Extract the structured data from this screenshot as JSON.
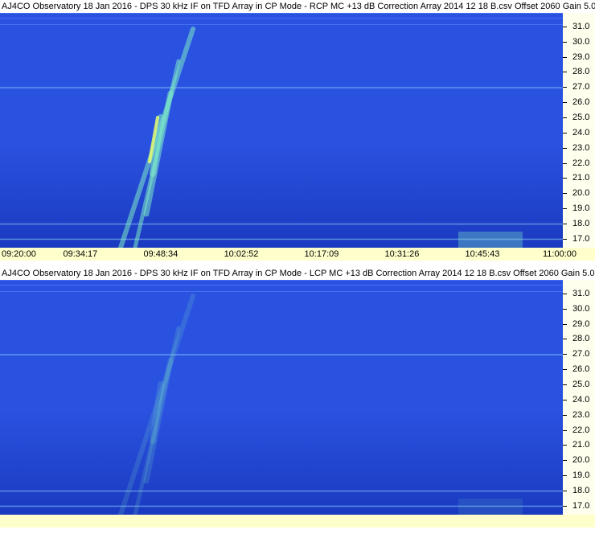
{
  "colors": {
    "spectrogram_base": "#2a52e0",
    "spectrogram_dark": "#1a3ac0",
    "burst": "#7de8c8",
    "burst_bright": "#e8ff70",
    "time_axis_bg": "#ffffcc",
    "freq_axis_bg": "#ffffee"
  },
  "chart_data": [
    {
      "type": "heatmap",
      "title": "AJ4CO Observatory 18 Jan 2016 - DPS 30 kHz IF on TFD Array in CP Mode - RCP  MC +13 dB  Correction Array 2014 12 18 B.csv  Offset 2060  Gain 5.0",
      "yticks": [
        "31.0",
        "30.0",
        "29.0",
        "28.0",
        "27.0",
        "26.0",
        "25.0",
        "24.0",
        "23.0",
        "22.0",
        "21.0",
        "20.0",
        "19.0",
        "18.0",
        "17.0"
      ],
      "xticks": [
        "09:20:00",
        "09:34:17",
        "09:48:34",
        "10:02:52",
        "10:17:09",
        "10:31:26",
        "10:45:43",
        "11:00:00"
      ],
      "ylim": [
        16.4,
        31.9
      ],
      "xlim": [
        "09:20:00",
        "11:00:00"
      ],
      "freq_lines_mhz": [
        27.0,
        18.0,
        17.0
      ]
    },
    {
      "type": "heatmap",
      "title": "AJ4CO Observatory 18 Jan 2016 - DPS 30 kHz IF on TFD Array in CP Mode - LCP  MC +13 dB  Correction Array 2014 12 18 B.csv  Offset 2060  Gain 5.0",
      "yticks": [
        "31.0",
        "30.0",
        "29.0",
        "28.0",
        "27.0",
        "26.0",
        "25.0",
        "24.0",
        "23.0",
        "22.0",
        "21.0",
        "20.0",
        "19.0",
        "18.0",
        "17.0"
      ],
      "xticks": [],
      "ylim": [
        16.4,
        31.9
      ],
      "xlim": [
        "09:20:00",
        "11:00:00"
      ],
      "freq_lines_mhz": [
        27.0,
        18.0,
        17.0
      ]
    }
  ]
}
